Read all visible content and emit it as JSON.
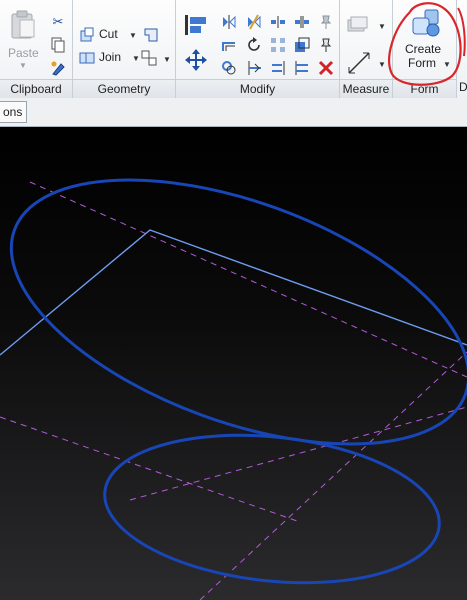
{
  "ribbon": {
    "clipboard": {
      "title": "Clipboard",
      "paste_label": "Paste"
    },
    "geometry": {
      "title": "Geometry",
      "cut_label": "Cut",
      "join_label": "Join"
    },
    "modify": {
      "title": "Modify"
    },
    "measure": {
      "title": "Measure"
    },
    "form": {
      "title": "Form",
      "create_form_line1": "Create",
      "create_form_line2": "Form"
    }
  },
  "options_bar": {
    "tab_label": "ons"
  },
  "annotations": {
    "highlight_color": "#d8262a"
  },
  "viewport": {
    "background_top": "#000000",
    "background_bottom": "#2b2b2d",
    "curve_color": "#1846b6",
    "line_color": "#6f9cf0",
    "reference_color": "#b45ad8"
  }
}
